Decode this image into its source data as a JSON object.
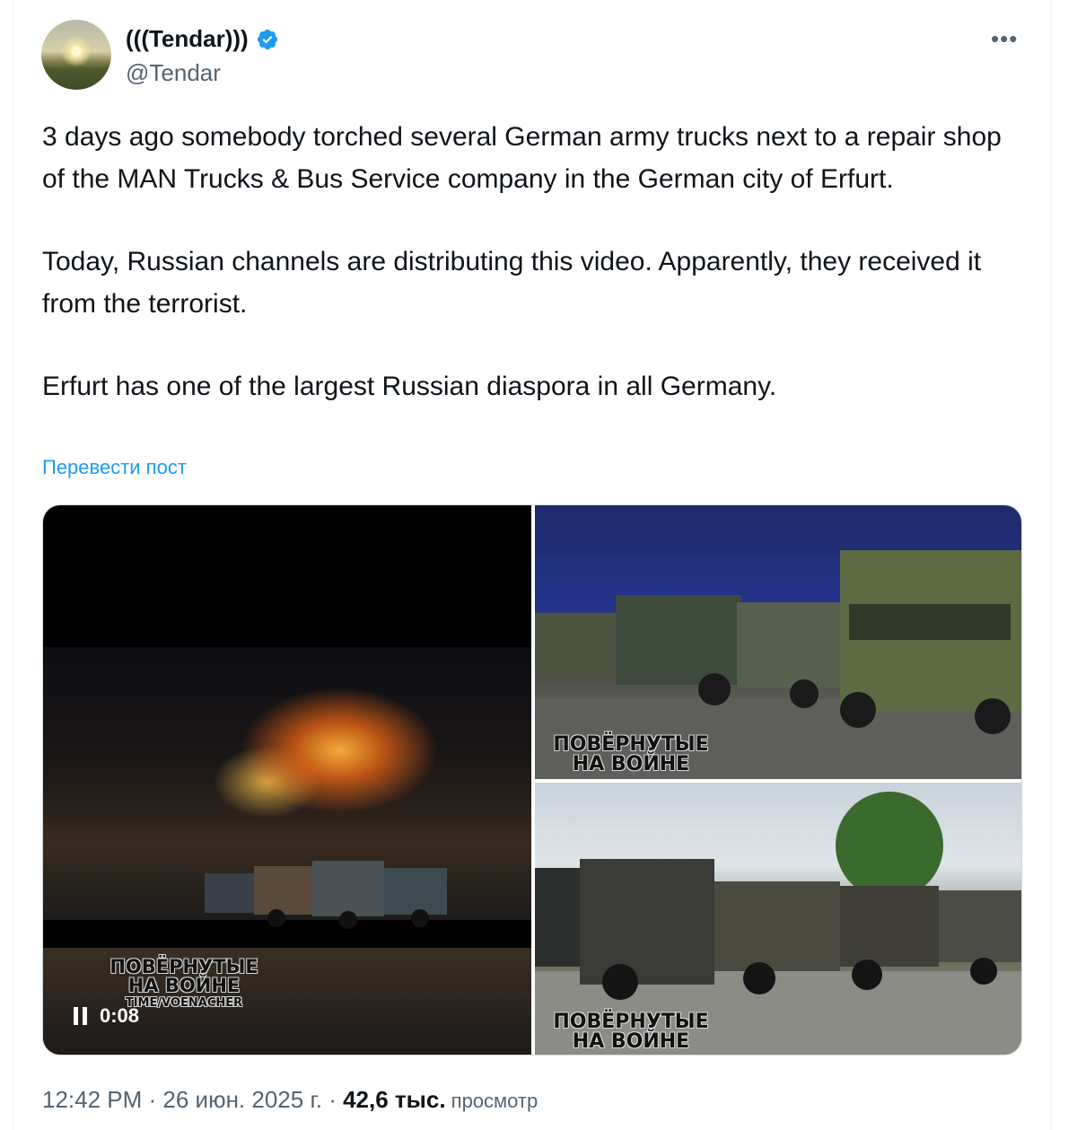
{
  "author": {
    "display_name": "(((Tendar)))",
    "handle": "@Tendar",
    "verified": true
  },
  "post": {
    "paragraphs": [
      "3 days ago somebody torched several German army trucks next to a repair shop of the MAN Trucks & Bus Service company in the German city of Erfurt.",
      "Today, Russian channels are distributing this video. Apparently, they received it from the terrorist.",
      "Erfurt has one of the largest Russian diaspora in all Germany."
    ],
    "translate_link": "Перевести пост"
  },
  "media": {
    "video": {
      "watermark_line1": "ПОВЁРНУТЫЕ",
      "watermark_line2": "НА ВОЙНЕ",
      "watermark_sub": "TIME/VOENACHER",
      "timestamp": "0:08"
    },
    "photo_top": {
      "watermark_line1": "ПОВЁРНУТЫЕ",
      "watermark_line2": "НА ВОЙНЕ"
    },
    "photo_bottom": {
      "watermark_line1": "ПОВЁРНУТЫЕ",
      "watermark_line2": "НА ВОЙНЕ"
    }
  },
  "meta": {
    "time": "12:42 PM",
    "separator": " · ",
    "date": "26 июн. 2025 г.",
    "separator2": " · ",
    "views_count": "42,6 тыс.",
    "views_label": " просмотр"
  },
  "colors": {
    "link": "#1d9bf0",
    "verified_badge": "#1d9bf0",
    "secondary_text": "#536471"
  },
  "icons": [
    "verified-badge-icon",
    "more-options-icon",
    "pause-icon"
  ]
}
